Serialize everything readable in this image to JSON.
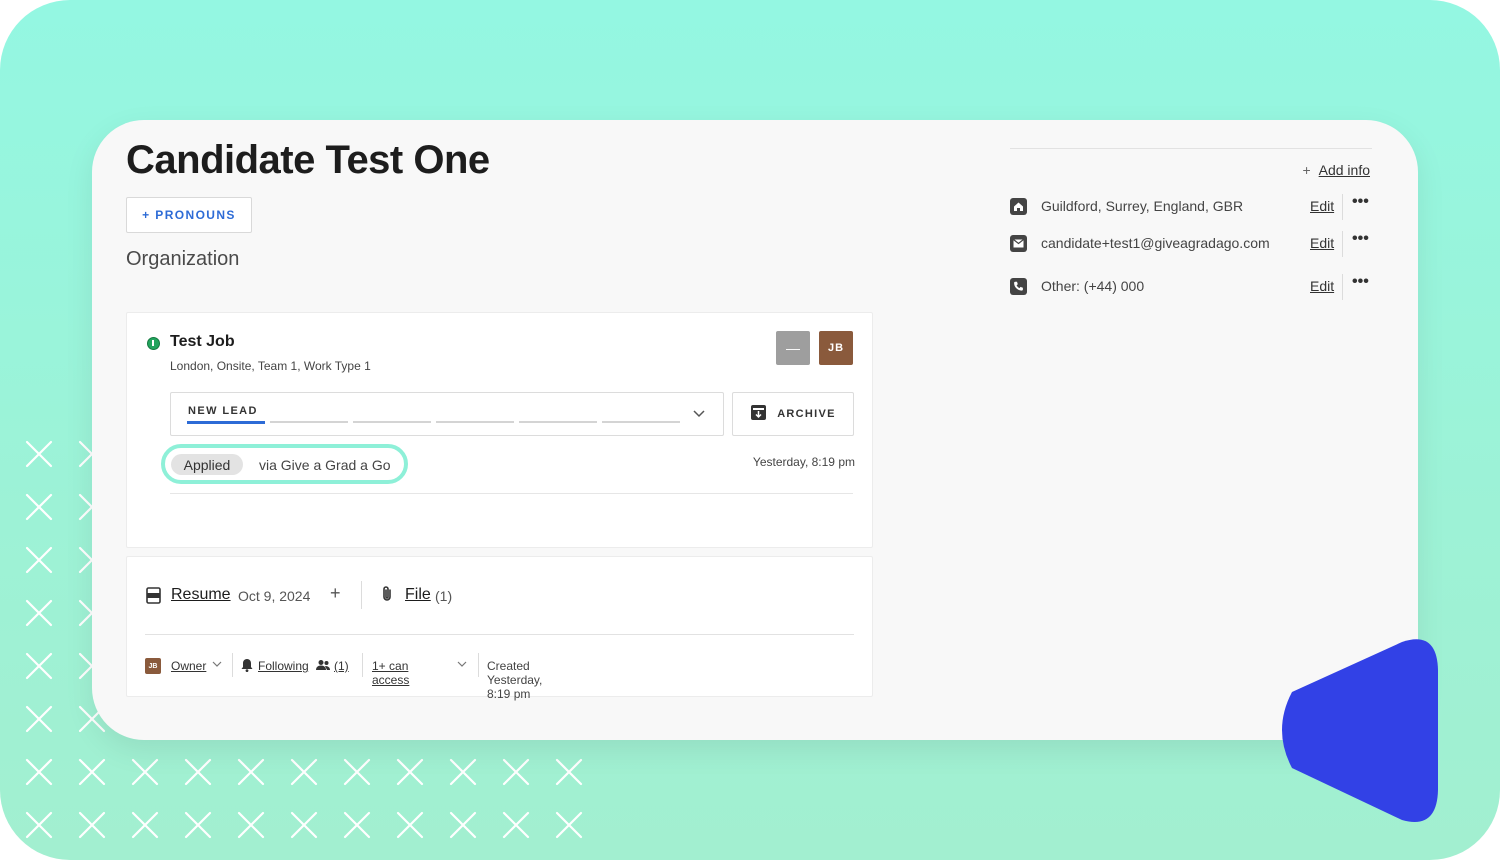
{
  "candidate": {
    "name": "Candidate Test One",
    "pronouns_button": "+ PRONOUNS",
    "organization_label": "Organization"
  },
  "job": {
    "title": "Test Job",
    "meta": "London, Onsite, Team 1, Work Type 1",
    "avatars": [
      "—",
      "JB"
    ],
    "stage": "NEW LEAD",
    "archive_label": "ARCHIVE",
    "applied_label": "Applied",
    "source": "via Give a Grad a Go",
    "timestamp": "Yesterday, 8:19 pm"
  },
  "files": {
    "resume_label": "Resume",
    "resume_date": "Oct 9, 2024",
    "add_symbol": "+",
    "file_label": "File",
    "file_count": "(1)",
    "owner_avatar": "JB",
    "owner_label": "Owner",
    "following_label": "Following",
    "followers_count": "(1)",
    "access_label": "1+ can access",
    "created": "Created Yesterday, 8:19 pm"
  },
  "contact": {
    "add_info_label": "Add info",
    "rows": [
      {
        "icon": "home-icon",
        "text": "Guildford, Surrey, England, GBR",
        "edit": "Edit",
        "more": "•••"
      },
      {
        "icon": "mail-icon",
        "text": "candidate+test1@giveagradago.com",
        "edit": "Edit",
        "more": "•••"
      },
      {
        "icon": "phone-icon",
        "text": "Other: (+44) 000",
        "edit": "Edit",
        "more": "•••"
      }
    ]
  },
  "colors": {
    "background": "#9af5dc",
    "accent_blue": "#2d6bd6",
    "highlight_ring": "#8ef0d8",
    "status_green": "#22a45d",
    "decor_triangle": "#3241e6"
  }
}
